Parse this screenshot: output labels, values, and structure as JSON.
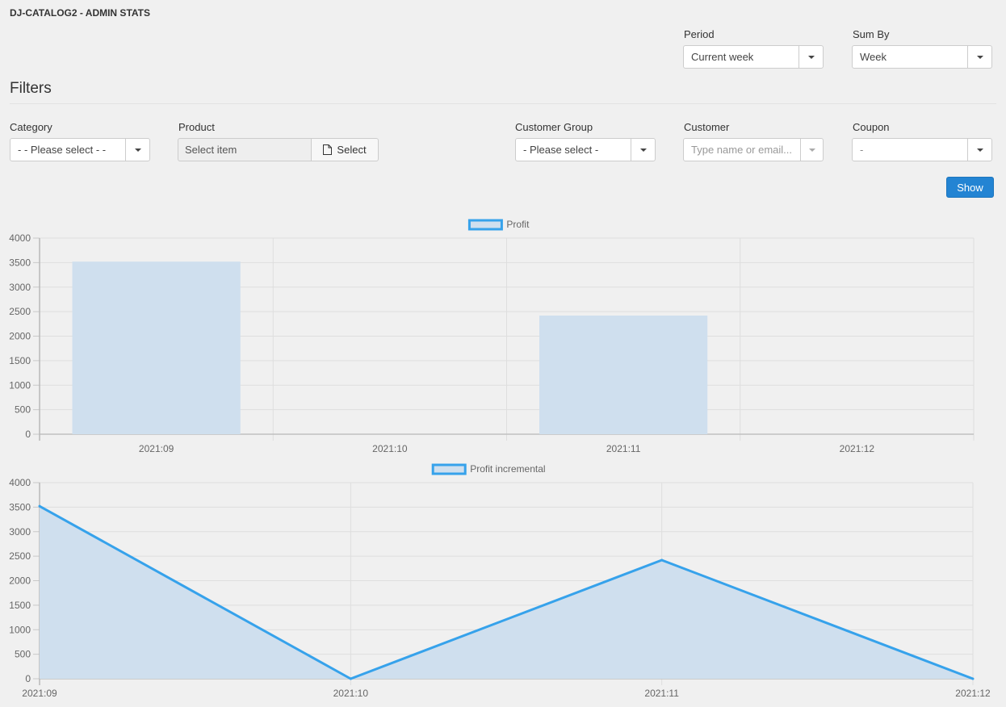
{
  "page": {
    "title": "DJ-CATALOG2 - ADMIN STATS"
  },
  "top_controls": {
    "period": {
      "label": "Period",
      "value": "Current week"
    },
    "sum_by": {
      "label": "Sum By",
      "value": "Week"
    }
  },
  "filters": {
    "heading": "Filters",
    "category": {
      "label": "Category",
      "value": "- - Please select - -"
    },
    "product": {
      "label": "Product",
      "input_value": "Select item",
      "button_label": "Select",
      "button_icon": "file-icon"
    },
    "customer_group": {
      "label": "Customer Group",
      "value": "- Please select -"
    },
    "customer": {
      "label": "Customer",
      "placeholder": "Type name or email..."
    },
    "coupon": {
      "label": "Coupon",
      "value": "-"
    },
    "show_button": "Show"
  },
  "colors": {
    "accent": "#2384d3",
    "series_fill": "#cfdfee",
    "series_line": "#36a2eb"
  },
  "chart_data": [
    {
      "type": "bar",
      "title": "",
      "legend": {
        "label": "Profit",
        "position": "top"
      },
      "categories": [
        "2021:09",
        "2021:10",
        "2021:11",
        "2021:12"
      ],
      "values": [
        3520,
        0,
        2420,
        0
      ],
      "xlabel": "",
      "ylabel": "",
      "ylim": [
        0,
        4000
      ],
      "yticks": [
        0,
        500,
        1000,
        1500,
        2000,
        2500,
        3000,
        3500,
        4000
      ],
      "grid": true
    },
    {
      "type": "area",
      "title": "",
      "legend": {
        "label": "Profit incremental",
        "position": "top"
      },
      "x": [
        "2021:09",
        "2021:10",
        "2021:11",
        "2021:12"
      ],
      "values": [
        3520,
        0,
        2420,
        0
      ],
      "xlabel": "",
      "ylabel": "",
      "ylim": [
        0,
        4000
      ],
      "yticks": [
        0,
        500,
        1000,
        1500,
        2000,
        2500,
        3000,
        3500,
        4000
      ],
      "grid": true
    }
  ]
}
